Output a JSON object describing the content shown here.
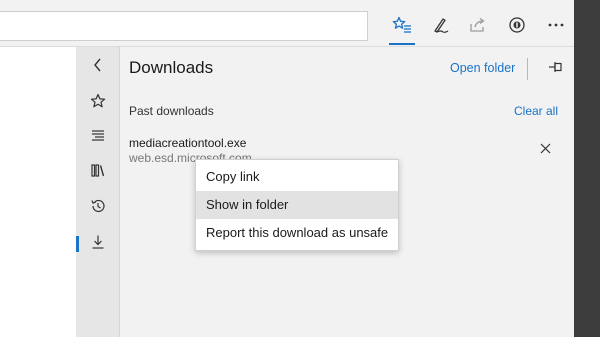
{
  "colors": {
    "accent": "#1a73c7",
    "panel_bg": "#f2f2f2",
    "rail_bg": "#e6e6e6",
    "frame": "#3c3c3c"
  },
  "toolbar": {
    "buttons": [
      {
        "icon": "favorites-star-icon",
        "active": true
      },
      {
        "icon": "pen-icon"
      },
      {
        "icon": "share-icon"
      },
      {
        "icon": "extension-icon"
      },
      {
        "icon": "more-icon"
      }
    ]
  },
  "rail": {
    "items": [
      "back-chevron-icon",
      "star-icon",
      "reading-list-icon",
      "books-icon",
      "history-icon",
      "download-icon"
    ],
    "active": "download-icon"
  },
  "panel": {
    "title": "Downloads",
    "open_folder": "Open folder",
    "section_label": "Past downloads",
    "clear_all": "Clear all",
    "download": {
      "file_name": "mediacreationtool.exe",
      "source": "web.esd.microsoft.com"
    }
  },
  "context_menu": {
    "items": [
      "Copy link",
      "Show in folder",
      "Report this download as unsafe"
    ],
    "highlighted": "Show in folder"
  }
}
